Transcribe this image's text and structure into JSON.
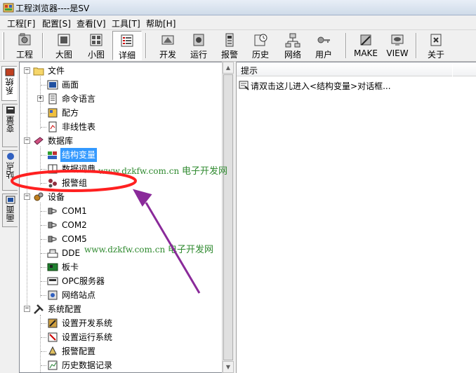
{
  "window": {
    "title": "工程浏览器----是SV"
  },
  "menu": [
    "工程[F]",
    "配置[S]",
    "查看[V]",
    "工具[T]",
    "帮助[H]"
  ],
  "toolbar": {
    "project": "工程",
    "big_icons": "大图",
    "small_icons": "小图",
    "details": "详细",
    "develop": "开发",
    "run": "运行",
    "alarm": "报警",
    "history": "历史",
    "network": "网络",
    "user": "用户",
    "make": "MAKE",
    "view": "VIEW",
    "about": "关于"
  },
  "side_tabs": {
    "system": "系统",
    "variables": "变量",
    "stations": "站点",
    "screens": "画面"
  },
  "tree": {
    "file": "文件",
    "screen": "画面",
    "command_language": "命令语言",
    "recipe": "配方",
    "nonlinear_table": "非线性表",
    "database": "数据库",
    "struct_variable": "结构变量",
    "data_dictionary": "数据词典",
    "alarm_group": "报警组",
    "devices": "设备",
    "com1": "COM1",
    "com2": "COM2",
    "com5": "COM5",
    "dde": "DDE",
    "board": "板卡",
    "opc_server": "OPC服务器",
    "network_station": "网络站点",
    "system_config": "系统配置",
    "dev_system_setup": "设置开发系统",
    "run_system_setup": "设置运行系统",
    "alarm_config": "报警配置",
    "history_record": "历史数据记录"
  },
  "right_pane": {
    "column_header": "提示",
    "hint": "请双击这儿进入<结构变量>对话框..."
  },
  "watermarks": [
    {
      "url": "www.dzkfw.com.cn",
      "name": "电子开发网"
    },
    {
      "url": "www.dzkfw.com.cn",
      "name": "电子开发网"
    }
  ],
  "colors": {
    "selection": "#3399ff",
    "annotation": "#ff2020",
    "arrow": "#8a2a9a",
    "watermark": "#2f8a2f"
  }
}
